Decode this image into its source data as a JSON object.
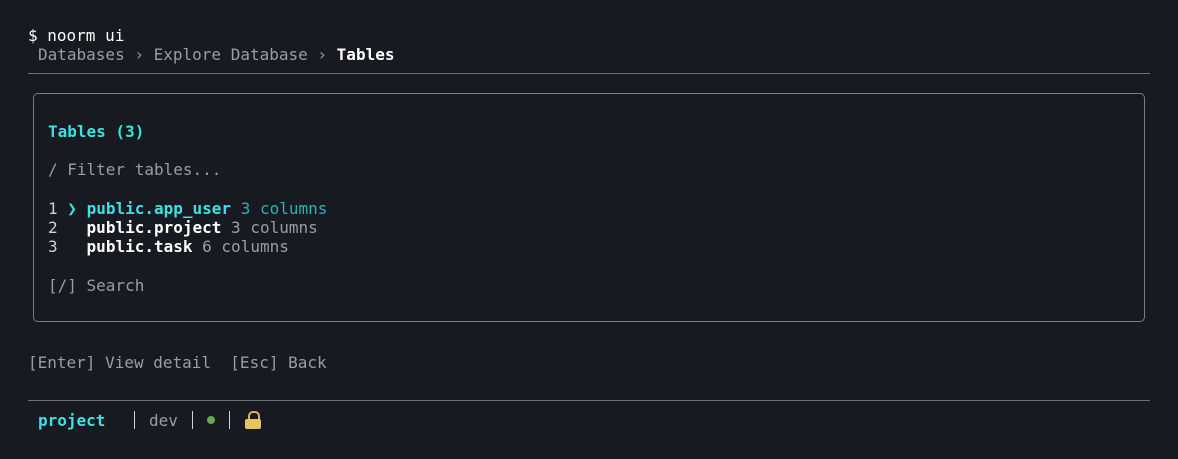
{
  "terminal": {
    "prompt": "$ noorm ui"
  },
  "breadcrumb": {
    "items": [
      "Databases",
      "Explore Database",
      "Tables"
    ],
    "separator": "›"
  },
  "panel": {
    "title": "Tables (3)",
    "filter_placeholder": "/ Filter tables...",
    "tables": [
      {
        "index": "1",
        "name": "public.app_user",
        "columns": "3 columns",
        "selected": true
      },
      {
        "index": "2",
        "name": "public.project",
        "columns": "3 columns",
        "selected": false
      },
      {
        "index": "3",
        "name": "public.task",
        "columns": "6 columns",
        "selected": false
      }
    ],
    "caret": "❯",
    "search_hint": "[/] Search"
  },
  "keys": {
    "enter": "[Enter] View detail",
    "esc": "[Esc] Back"
  },
  "statusbar": {
    "project": "project",
    "env": "dev",
    "connection_status": "connected",
    "locked_icon": "lock-icon"
  },
  "colors": {
    "background": "#171a21",
    "accent": "#3ee0e0",
    "muted": "#9a9da3",
    "ok": "#6aa84f",
    "lock": "#e6c36a"
  }
}
